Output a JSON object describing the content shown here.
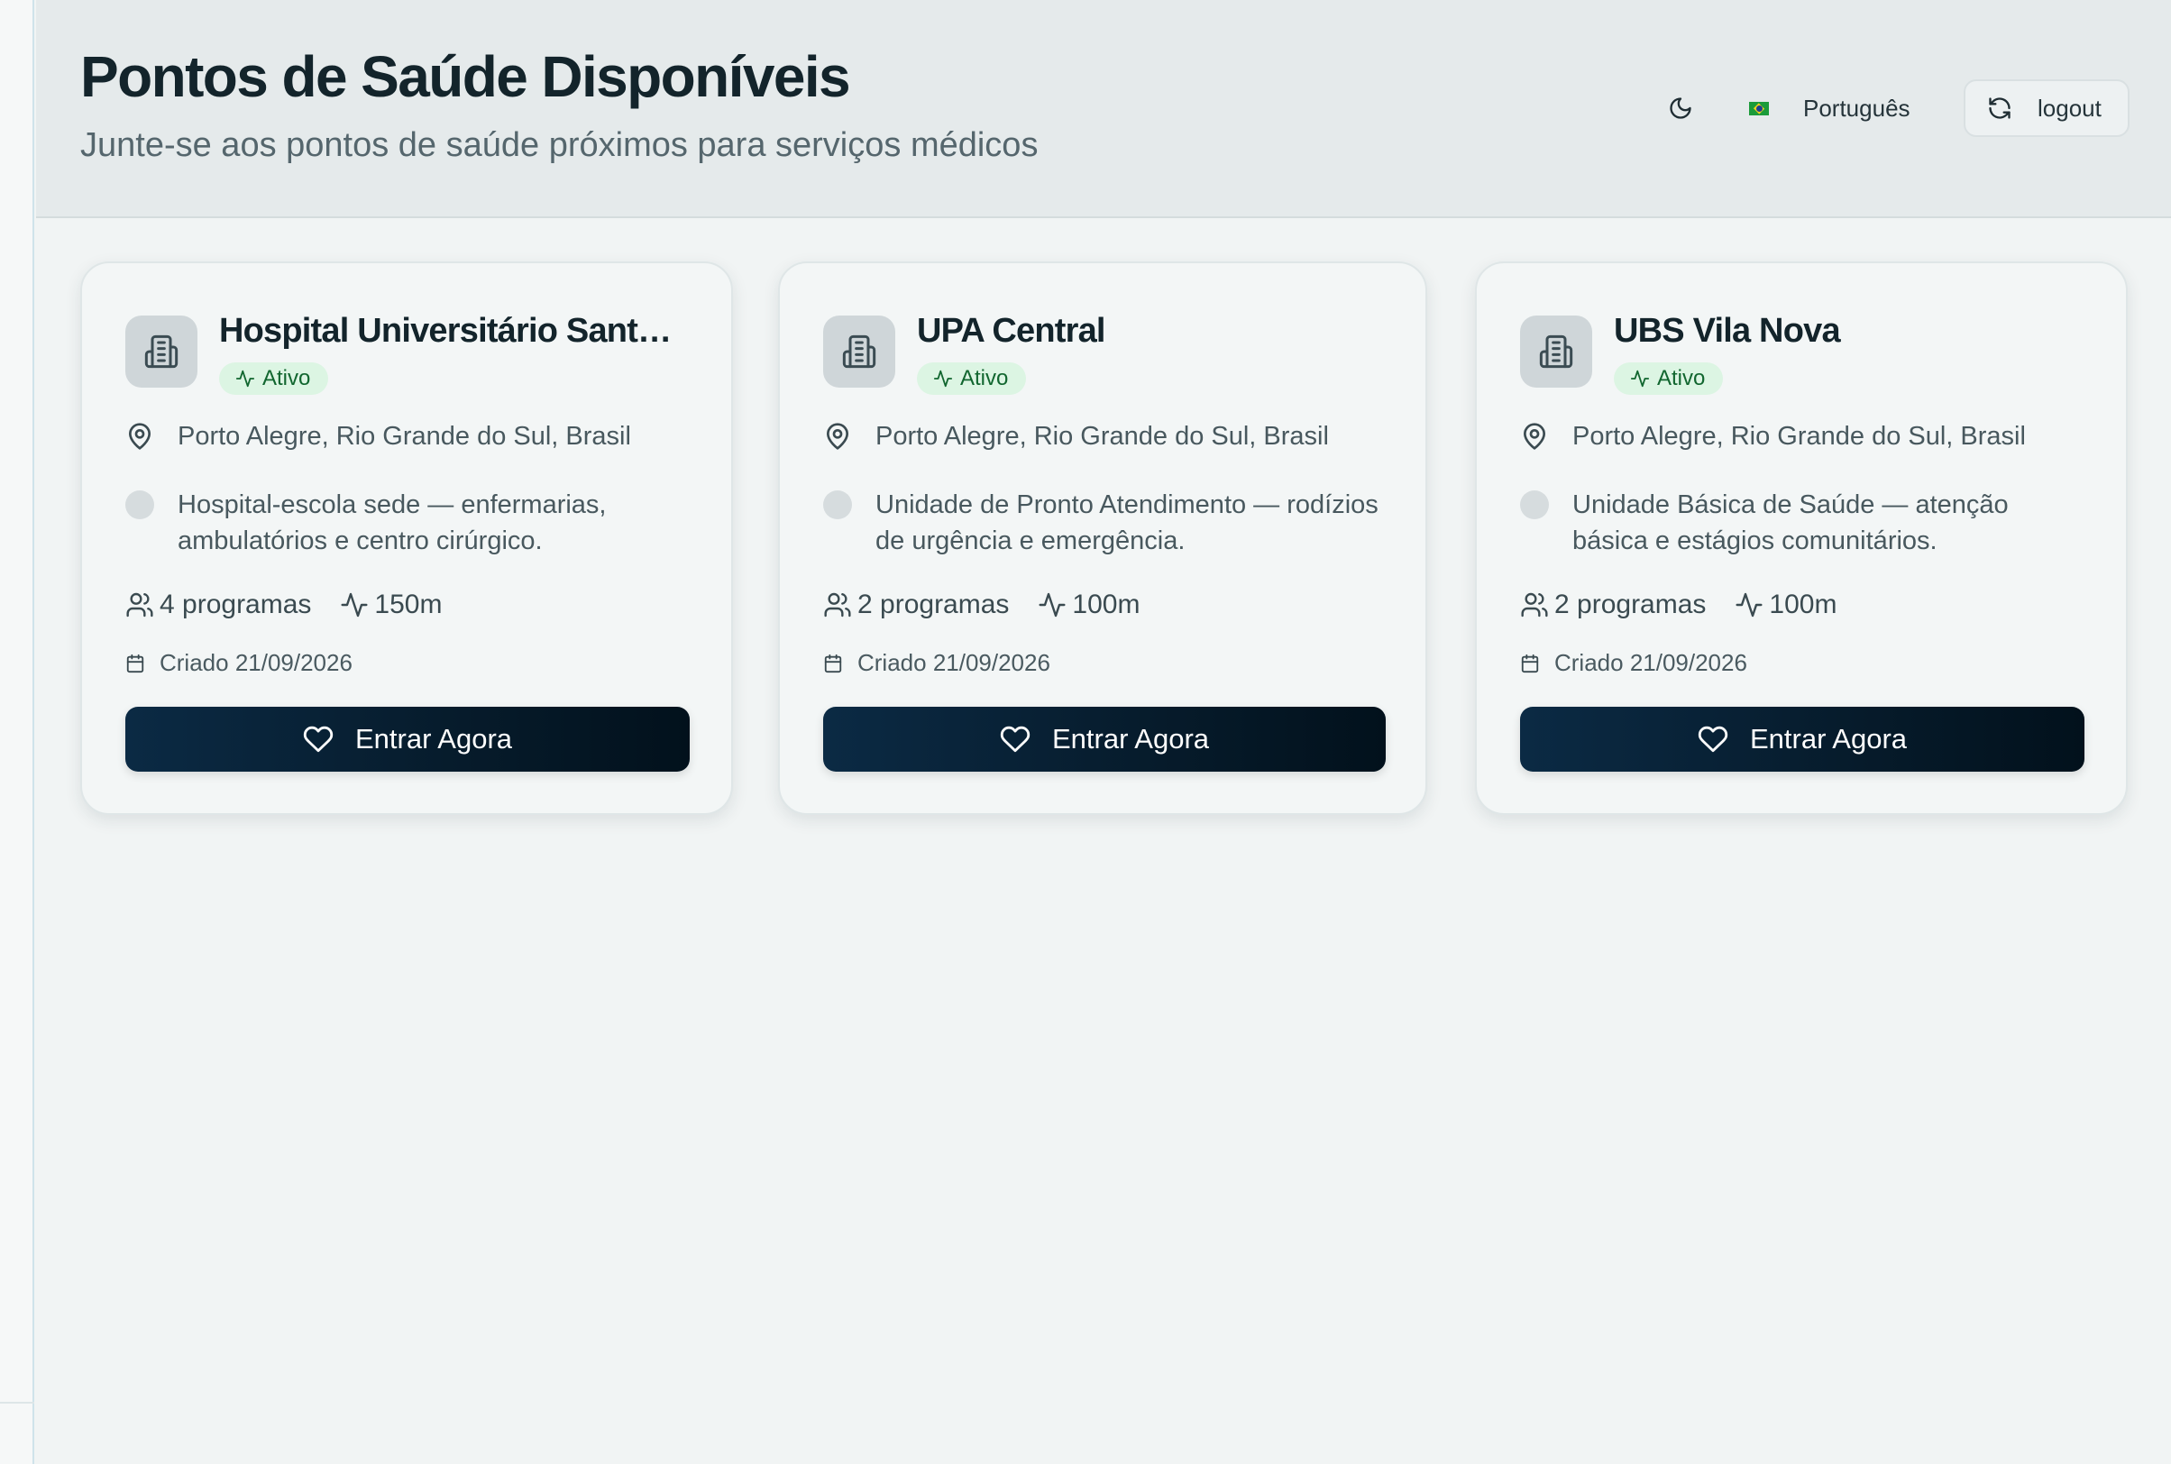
{
  "header": {
    "title": "Pontos de Saúde Disponíveis",
    "subtitle": "Junte-se aos pontos de saúde próximos para serviços médicos",
    "language": "Português",
    "logout_label": "logout"
  },
  "icons": {
    "theme": "moon-icon",
    "language_flag": "brazil-flag-icon",
    "logout": "refresh-icon",
    "card": "building-icon",
    "status": "activity-icon",
    "location": "map-pin-icon",
    "programs": "users-icon",
    "distance": "activity-icon",
    "date": "calendar-icon",
    "enter": "heart-icon"
  },
  "colors": {
    "status_active_bg": "#dcf5e3",
    "status_active_text": "#11662f",
    "button_dark": "#061b2b"
  },
  "cards": [
    {
      "name": "Hospital Universitário Santa M...",
      "status": "Ativo",
      "location": "Porto Alegre, Rio Grande do Sul, Brasil",
      "description": "Hospital-escola sede — enfermarias, ambulatórios e centro cirúrgico.",
      "programs": "4 programas",
      "distance": "150m",
      "created": "Criado 21/09/2026",
      "button_label": "Entrar Agora"
    },
    {
      "name": "UPA Central",
      "status": "Ativo",
      "location": "Porto Alegre, Rio Grande do Sul, Brasil",
      "description": "Unidade de Pronto Atendimento — rodízios de urgência e emergência.",
      "programs": "2 programas",
      "distance": "100m",
      "created": "Criado 21/09/2026",
      "button_label": "Entrar Agora"
    },
    {
      "name": "UBS Vila Nova",
      "status": "Ativo",
      "location": "Porto Alegre, Rio Grande do Sul, Brasil",
      "description": "Unidade Básica de Saúde — atenção básica e estágios comunitários.",
      "programs": "2 programas",
      "distance": "100m",
      "created": "Criado 21/09/2026",
      "button_label": "Entrar Agora"
    }
  ]
}
